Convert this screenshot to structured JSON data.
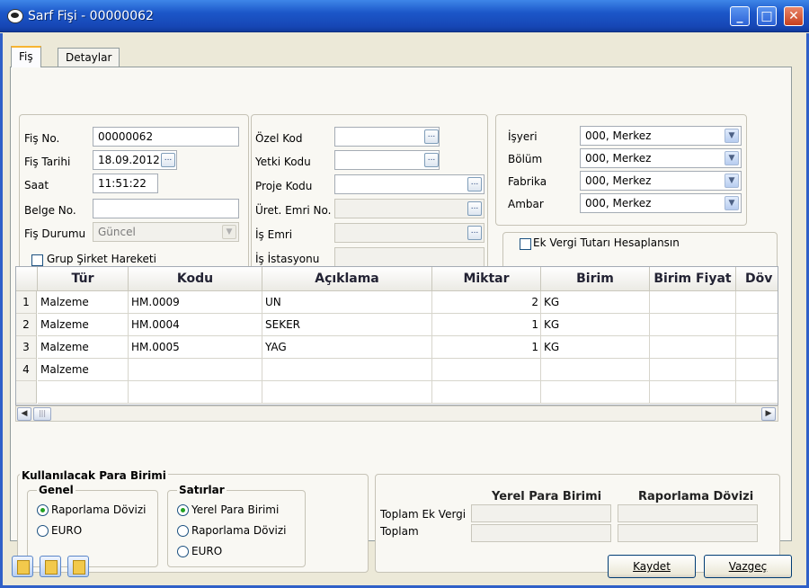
{
  "window": {
    "title": "Sarf Fişi - 00000062",
    "minimize": "_",
    "maximize": "□",
    "close": "✕"
  },
  "tabs": [
    {
      "label": "Fiş",
      "active": true
    },
    {
      "label": "Detaylar",
      "active": false
    }
  ],
  "header_left": {
    "fis_no": {
      "label": "Fiş No.",
      "value": "00000062"
    },
    "fis_tarihi": {
      "label": "Fiş Tarihi",
      "value": "18.09.2012"
    },
    "saat": {
      "label": "Saat",
      "value": "11:51:22"
    },
    "belge_no": {
      "label": "Belge No.",
      "value": ""
    },
    "fis_durumu": {
      "label": "Fiş Durumu",
      "value": "Güncel"
    },
    "grup_sirket": {
      "label": "Grup Şirket Hareketi",
      "checked": false
    }
  },
  "header_mid": {
    "ozel_kod": {
      "label": "Özel Kod",
      "value": ""
    },
    "yetki_kodu": {
      "label": "Yetki Kodu",
      "value": ""
    },
    "proje_kodu": {
      "label": "Proje Kodu",
      "value": ""
    },
    "uret_emri_no": {
      "label": "Üret. Emri No.",
      "value": ""
    },
    "is_emri": {
      "label": "İş Emri",
      "value": ""
    },
    "is_istasyonu": {
      "label": "İş İstasyonu",
      "value": ""
    }
  },
  "header_right": {
    "isyeri": {
      "label": "İşyeri",
      "value": "000, Merkez"
    },
    "bolum": {
      "label": "Bölüm",
      "value": "000, Merkez"
    },
    "fabrika": {
      "label": "Fabrika",
      "value": "000, Merkez"
    },
    "ambar": {
      "label": "Ambar",
      "value": "000, Merkez"
    },
    "ek_vergi": {
      "label": "Ek Vergi Tutarı Hesaplansın",
      "checked": false
    }
  },
  "grid": {
    "columns": [
      "Tür",
      "Kodu",
      "Açıklama",
      "Miktar",
      "Birim",
      "Birim Fiyat",
      "Döv"
    ],
    "rows": [
      {
        "no": "1",
        "tur": "Malzeme",
        "kodu": "HM.0009",
        "aciklama": "UN",
        "miktar": "2",
        "birim": "KG",
        "birim_fiyat": ""
      },
      {
        "no": "2",
        "tur": "Malzeme",
        "kodu": "HM.0004",
        "aciklama": "SEKER",
        "miktar": "1",
        "birim": "KG",
        "birim_fiyat": ""
      },
      {
        "no": "3",
        "tur": "Malzeme",
        "kodu": "HM.0005",
        "aciklama": "YAG",
        "miktar": "1",
        "birim": "KG",
        "birim_fiyat": ""
      },
      {
        "no": "4",
        "tur": "Malzeme",
        "kodu": "",
        "aciklama": "",
        "miktar": "",
        "birim": "",
        "birim_fiyat": ""
      }
    ]
  },
  "currency": {
    "title": "Kullanılacak Para Birimi",
    "genel": {
      "title": "Genel",
      "options": [
        {
          "label": "Raporlama Dövizi",
          "selected": true
        },
        {
          "label": "EURO",
          "selected": false
        }
      ]
    },
    "satirlar": {
      "title": "Satırlar",
      "options": [
        {
          "label": "Yerel Para Birimi",
          "selected": true
        },
        {
          "label": "Raporlama Dövizi",
          "selected": false
        },
        {
          "label": "EURO",
          "selected": false
        }
      ]
    }
  },
  "totals": {
    "col_local": "Yerel Para Birimi",
    "col_report": "Raporlama Dövizi",
    "rows": [
      {
        "label": "Toplam Ek Vergi",
        "local": "",
        "report": ""
      },
      {
        "label": "Toplam",
        "local": "",
        "report": ""
      }
    ]
  },
  "footer": {
    "save": "Kaydet",
    "cancel": "Vazgeç"
  },
  "colors": {
    "titlebar": "#1c57c9",
    "tab_highlight": "#f7b431",
    "radio_selected": "#21a121"
  }
}
